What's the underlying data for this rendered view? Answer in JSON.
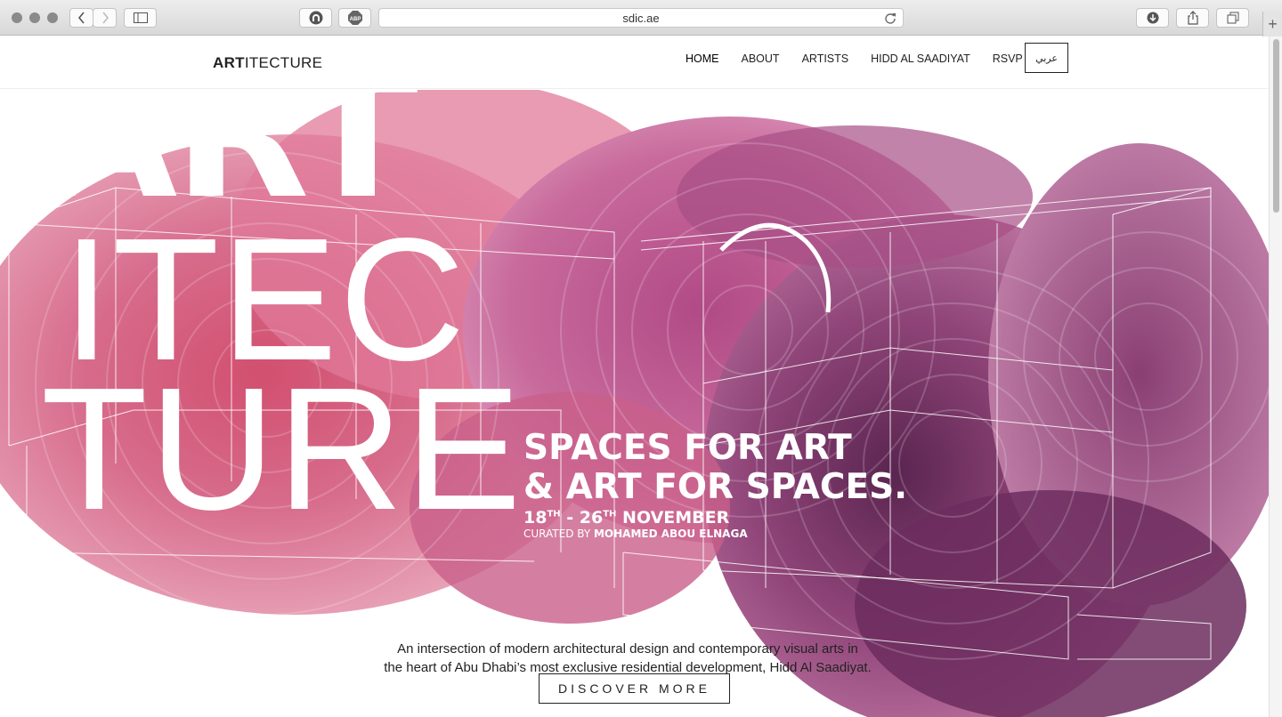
{
  "browser": {
    "url": "sdic.ae",
    "icons": [
      "back-icon",
      "forward-icon",
      "sidebar-icon",
      "extension-icon",
      "adblock-icon",
      "reload-icon",
      "download-icon",
      "share-icon",
      "tabs-icon",
      "new-tab-icon"
    ],
    "adblock_label": "ABP",
    "new_tab_label": "+"
  },
  "site": {
    "logo_bold": "ART",
    "logo_rest": "ITECTURE",
    "nav": [
      {
        "label": "HOME"
      },
      {
        "label": "ABOUT"
      },
      {
        "label": "ARTISTS"
      },
      {
        "label": "HIDD AL SAADIYAT"
      },
      {
        "label": "RSVP"
      }
    ],
    "lang_button": "عربي"
  },
  "hero": {
    "big_lines": [
      "ART",
      "ITEC",
      "TURE"
    ],
    "tagline_1": "SPACES FOR ART",
    "tagline_2": "& ART FOR SPACES.",
    "dates": {
      "d1": "18",
      "s1": "TH",
      "sep": " - ",
      "d2": "26",
      "s2": "TH",
      "month": " NOVEMBER"
    },
    "curated_prefix": "CURATED BY ",
    "curator": "MOHAMED ABOU ELNAGA",
    "intro_line_1": "An intersection of modern architectural design and contemporary visual arts in",
    "intro_line_2": "the heart of Abu Dhabi’s most exclusive residential development, Hidd Al Saadiyat.",
    "cta": "DISCOVER MORE"
  },
  "colors": {
    "paint_light": "#e9a3bd",
    "paint_mid": "#c9628f",
    "paint_deep": "#8f3e6f",
    "paint_dark": "#5a2550",
    "text_dark": "#222222"
  }
}
